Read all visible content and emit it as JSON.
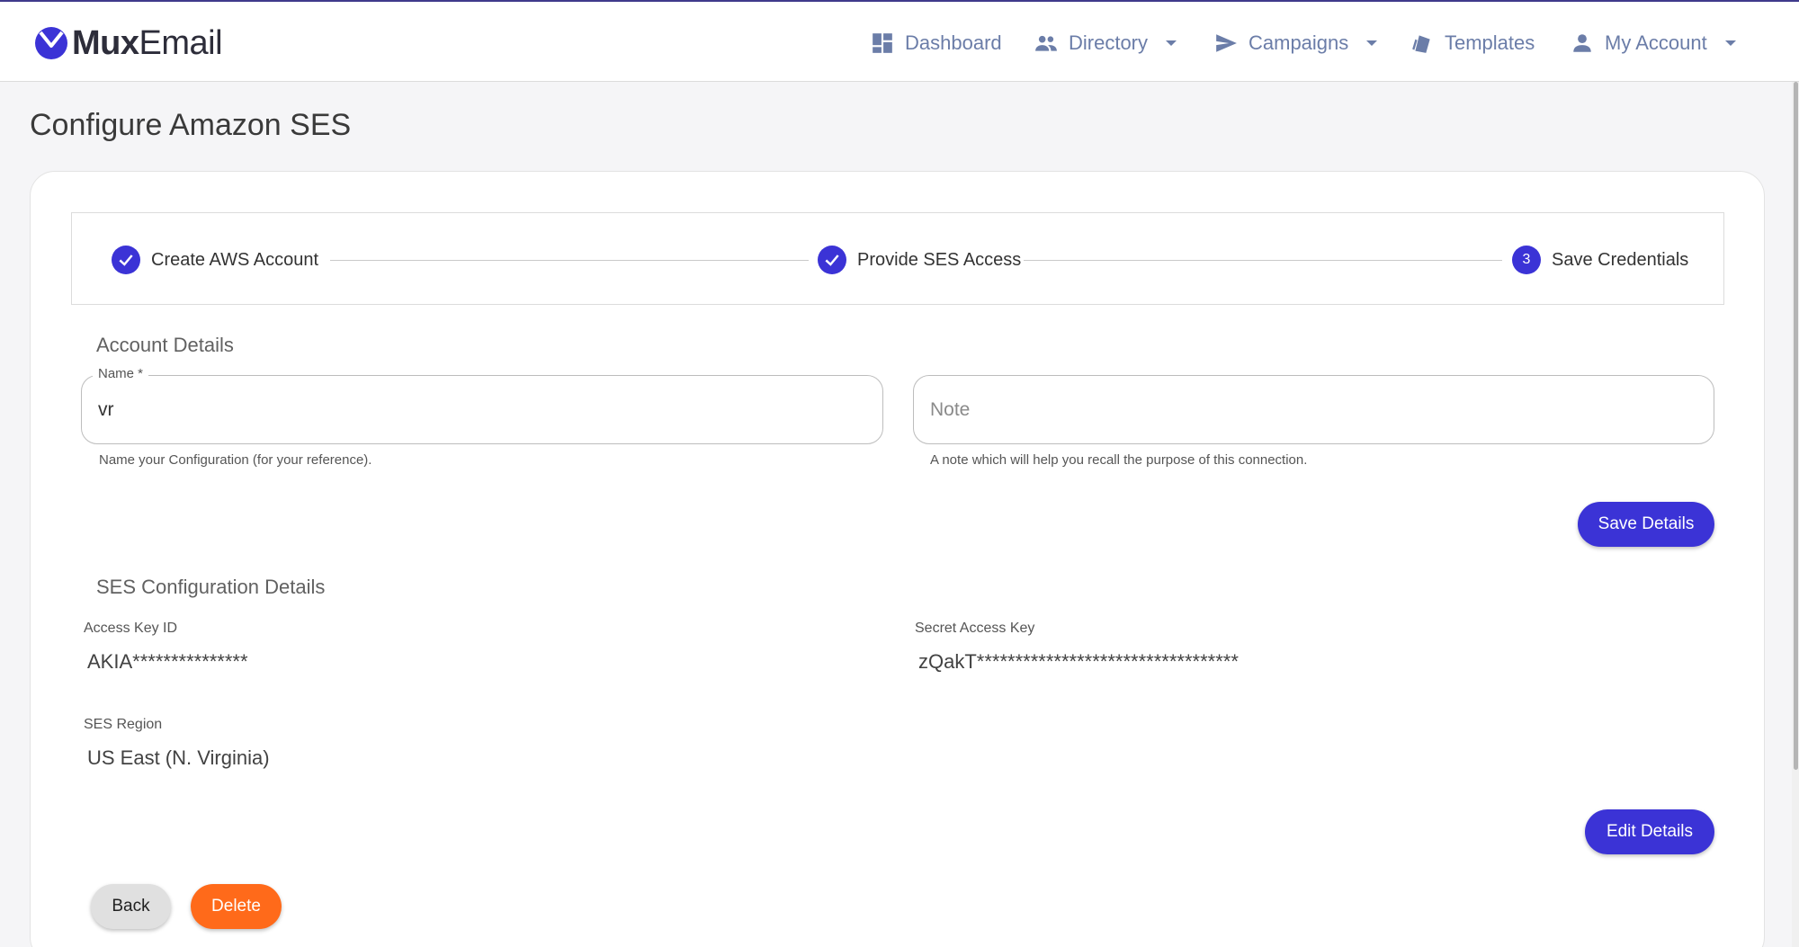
{
  "brand": {
    "name_bold": "Mux",
    "name_light": "Email",
    "accent": "#3b33d6"
  },
  "nav": {
    "dashboard": "Dashboard",
    "directory": "Directory",
    "campaigns": "Campaigns",
    "templates": "Templates",
    "account": "My Account"
  },
  "page": {
    "title": "Configure Amazon SES"
  },
  "stepper": {
    "steps": [
      {
        "label": "Create AWS Account",
        "state": "done"
      },
      {
        "label": "Provide SES Access",
        "state": "done"
      },
      {
        "label": "Save Credentials",
        "number": "3",
        "state": "active"
      }
    ]
  },
  "account_details": {
    "title": "Account Details",
    "name_label": "Name *",
    "name_value": "vr",
    "name_helper": "Name your Configuration (for your reference).",
    "note_placeholder": "Note",
    "note_helper": "A note which will help you recall the purpose of this connection.",
    "save_label": "Save Details"
  },
  "ses_details": {
    "title": "SES Configuration Details",
    "access_key_label": "Access Key ID",
    "access_key_value": "AKIA***************",
    "secret_key_label": "Secret Access Key",
    "secret_key_value": "zQakT**********************************",
    "region_label": "SES Region",
    "region_value": "US East (N. Virginia)",
    "edit_label": "Edit Details"
  },
  "actions": {
    "back_label": "Back",
    "delete_label": "Delete"
  }
}
